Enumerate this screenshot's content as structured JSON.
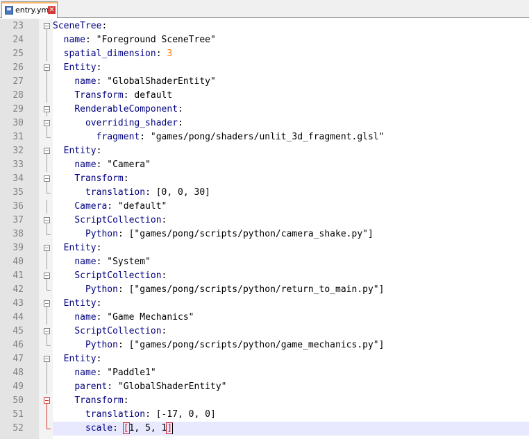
{
  "tab": {
    "filename": "entry.yml",
    "close_glyph": "✕"
  },
  "colors": {
    "key": "#000080",
    "string": "#000000",
    "number": "#ff8000",
    "brace_match": "#d02020",
    "current_line": "#e8e8ff",
    "gutter": "#e4e4e4",
    "line_number": "#808080"
  },
  "editor": {
    "current_line": 52,
    "lines": [
      {
        "n": 23,
        "indent": 0,
        "key": "SceneTree",
        "value": "",
        "fold": "start"
      },
      {
        "n": 24,
        "indent": 1,
        "key": "name",
        "value": "\"Foreground SceneTree\"",
        "fold": "inner"
      },
      {
        "n": 25,
        "indent": 1,
        "key": "spatial_dimension",
        "value": "3",
        "vtype": "number",
        "fold": "inner"
      },
      {
        "n": 26,
        "indent": 1,
        "key": "Entity",
        "value": "",
        "fold": "start"
      },
      {
        "n": 27,
        "indent": 2,
        "key": "name",
        "value": "\"GlobalShaderEntity\"",
        "fold": "inner"
      },
      {
        "n": 28,
        "indent": 2,
        "key": "Transform",
        "value": "default",
        "fold": "inner"
      },
      {
        "n": 29,
        "indent": 2,
        "key": "RenderableComponent",
        "value": "",
        "fold": "start"
      },
      {
        "n": 30,
        "indent": 3,
        "key": "overriding_shader",
        "value": "",
        "fold": "start"
      },
      {
        "n": 31,
        "indent": 4,
        "key": "fragment",
        "value": "\"games/pong/shaders/unlit_3d_fragment.glsl\"",
        "fold": "end"
      },
      {
        "n": 32,
        "indent": 1,
        "key": "Entity",
        "value": "",
        "fold": "start"
      },
      {
        "n": 33,
        "indent": 2,
        "key": "name",
        "value": "\"Camera\"",
        "fold": "inner"
      },
      {
        "n": 34,
        "indent": 2,
        "key": "Transform",
        "value": "",
        "fold": "start"
      },
      {
        "n": 35,
        "indent": 3,
        "key": "translation",
        "value": "[0, 0, 30]",
        "fold": "end"
      },
      {
        "n": 36,
        "indent": 2,
        "key": "Camera",
        "value": "\"default\"",
        "fold": "inner"
      },
      {
        "n": 37,
        "indent": 2,
        "key": "ScriptCollection",
        "value": "",
        "fold": "start"
      },
      {
        "n": 38,
        "indent": 3,
        "key": "Python",
        "value": "[\"games/pong/scripts/python/camera_shake.py\"]",
        "fold": "end"
      },
      {
        "n": 39,
        "indent": 1,
        "key": "Entity",
        "value": "",
        "fold": "start"
      },
      {
        "n": 40,
        "indent": 2,
        "key": "name",
        "value": "\"System\"",
        "fold": "inner"
      },
      {
        "n": 41,
        "indent": 2,
        "key": "ScriptCollection",
        "value": "",
        "fold": "start"
      },
      {
        "n": 42,
        "indent": 3,
        "key": "Python",
        "value": "[\"games/pong/scripts/python/return_to_main.py\"]",
        "fold": "end"
      },
      {
        "n": 43,
        "indent": 1,
        "key": "Entity",
        "value": "",
        "fold": "start"
      },
      {
        "n": 44,
        "indent": 2,
        "key": "name",
        "value": "\"Game Mechanics\"",
        "fold": "inner"
      },
      {
        "n": 45,
        "indent": 2,
        "key": "ScriptCollection",
        "value": "",
        "fold": "start"
      },
      {
        "n": 46,
        "indent": 3,
        "key": "Python",
        "value": "[\"games/pong/scripts/python/game_mechanics.py\"]",
        "fold": "end"
      },
      {
        "n": 47,
        "indent": 1,
        "key": "Entity",
        "value": "",
        "fold": "start"
      },
      {
        "n": 48,
        "indent": 2,
        "key": "name",
        "value": "\"Paddle1\"",
        "fold": "inner"
      },
      {
        "n": 49,
        "indent": 2,
        "key": "parent",
        "value": "\"GlobalShaderEntity\"",
        "fold": "inner"
      },
      {
        "n": 50,
        "indent": 2,
        "key": "Transform",
        "value": "",
        "fold": "start-active"
      },
      {
        "n": 51,
        "indent": 3,
        "key": "translation",
        "value": "[-17, 0, 0]",
        "fold": "inner-active"
      },
      {
        "n": 52,
        "indent": 3,
        "key": "scale",
        "value": "[1, 5, 1]",
        "vtype": "brace-match",
        "fold": "end-active"
      }
    ]
  }
}
